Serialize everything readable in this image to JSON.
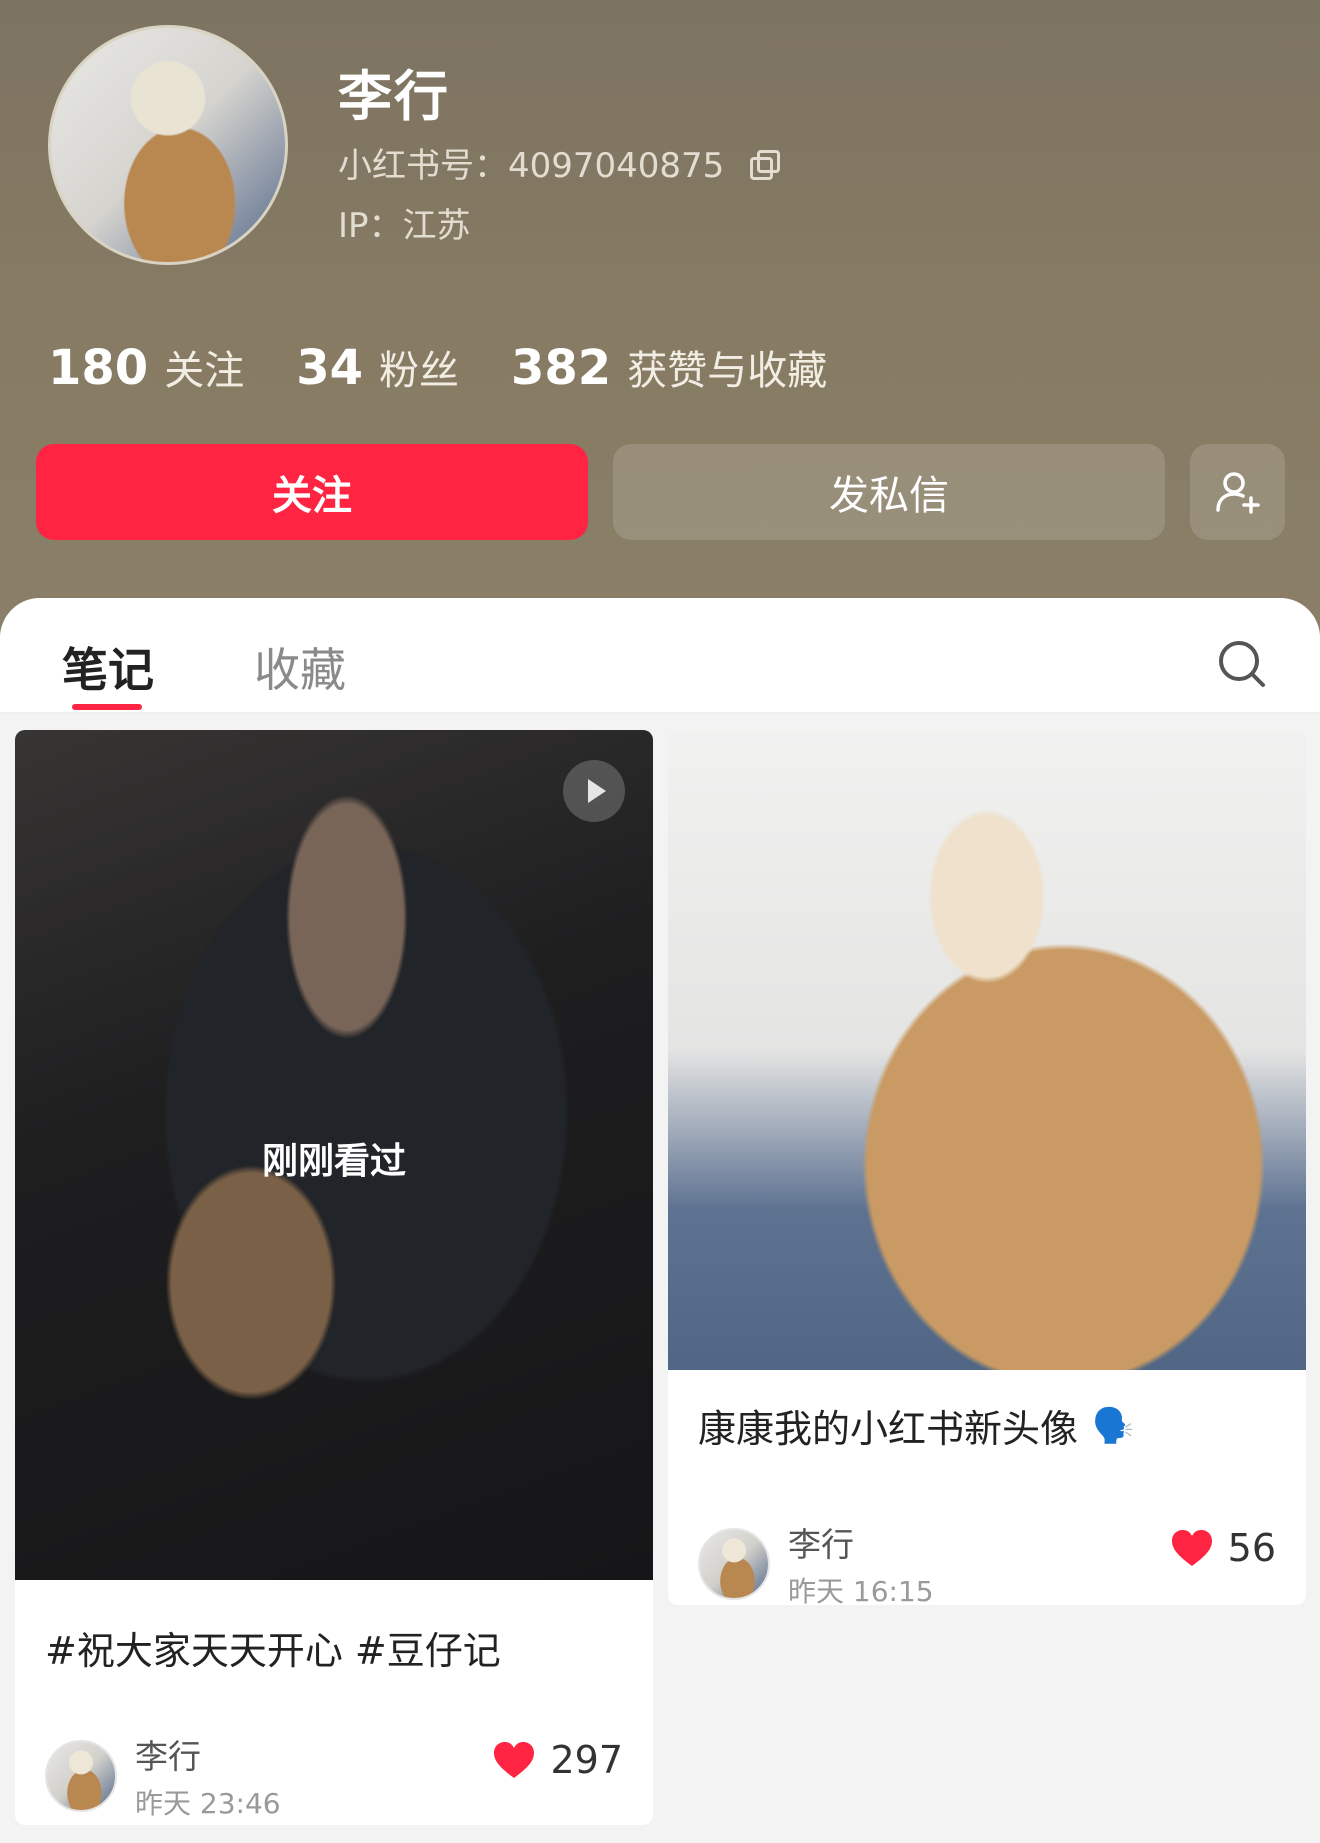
{
  "profile": {
    "name": "李行",
    "id_label": "小红书号：",
    "id_value": "4097040875",
    "ip_label": "IP：",
    "ip_value": "江苏"
  },
  "stats": [
    {
      "num": "180",
      "label": "关注"
    },
    {
      "num": "34",
      "label": "粉丝"
    },
    {
      "num": "382",
      "label": "获赞与收藏"
    }
  ],
  "actions": {
    "follow": "关注",
    "message": "发私信"
  },
  "tabs": {
    "notes": "笔记",
    "collect": "收藏"
  },
  "posts": [
    {
      "overlay": "刚刚看过",
      "title": "#祝大家天天开心 #豆仔记",
      "author": "李行",
      "time": "昨天 23:46",
      "likes": "297"
    },
    {
      "title": "康康我的小红书新头像",
      "emoji": "🗣️",
      "author": "李行",
      "time": "昨天 16:15",
      "likes": "56"
    }
  ],
  "colors": {
    "accent": "#ff2441",
    "header_bg": "#867a63"
  }
}
